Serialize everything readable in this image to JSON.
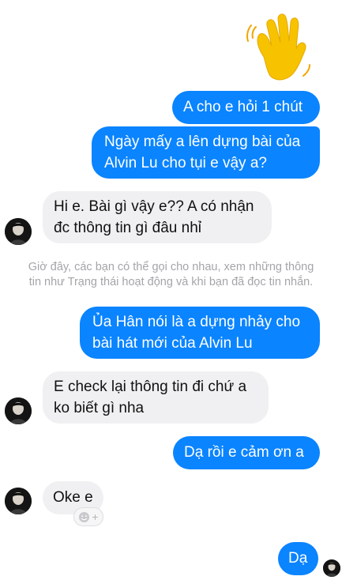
{
  "messages": [
    {
      "text": "A cho e hỏi 1 chút"
    },
    {
      "line1": "Ngày mấy a lên dựng bài của",
      "line2": "Alvin Lu cho tụi e vậy a?"
    },
    {
      "line1": "Hi e. Bài gì vậy e?? A có nhận",
      "line2": "đc thông tin gì đâu nhỉ"
    },
    {
      "line1": "Ủa Hân nói là a dựng nhảy cho",
      "line2": "bài hát mới của Alvin Lu"
    },
    {
      "line1": "E check lại thông tin đi chứ a",
      "line2": "ko biết gì nha"
    },
    {
      "text": "Dạ rồi e cảm ơn a"
    },
    {
      "text": "Oke e"
    },
    {
      "text": "Dạ"
    }
  ],
  "notice": {
    "line1": "Giờ đây, các bạn có thể gọi cho nhau, xem những thông",
    "line2": "tin như Trạng thái hoạt động và khi bạn đã đọc tin nhắn."
  },
  "react_button": {
    "icon": "smiley-plus-icon",
    "plus": "+"
  },
  "colors": {
    "outgoing": "#0a84ff",
    "incoming": "#f0f0f2",
    "notice": "#a5a5aa"
  }
}
